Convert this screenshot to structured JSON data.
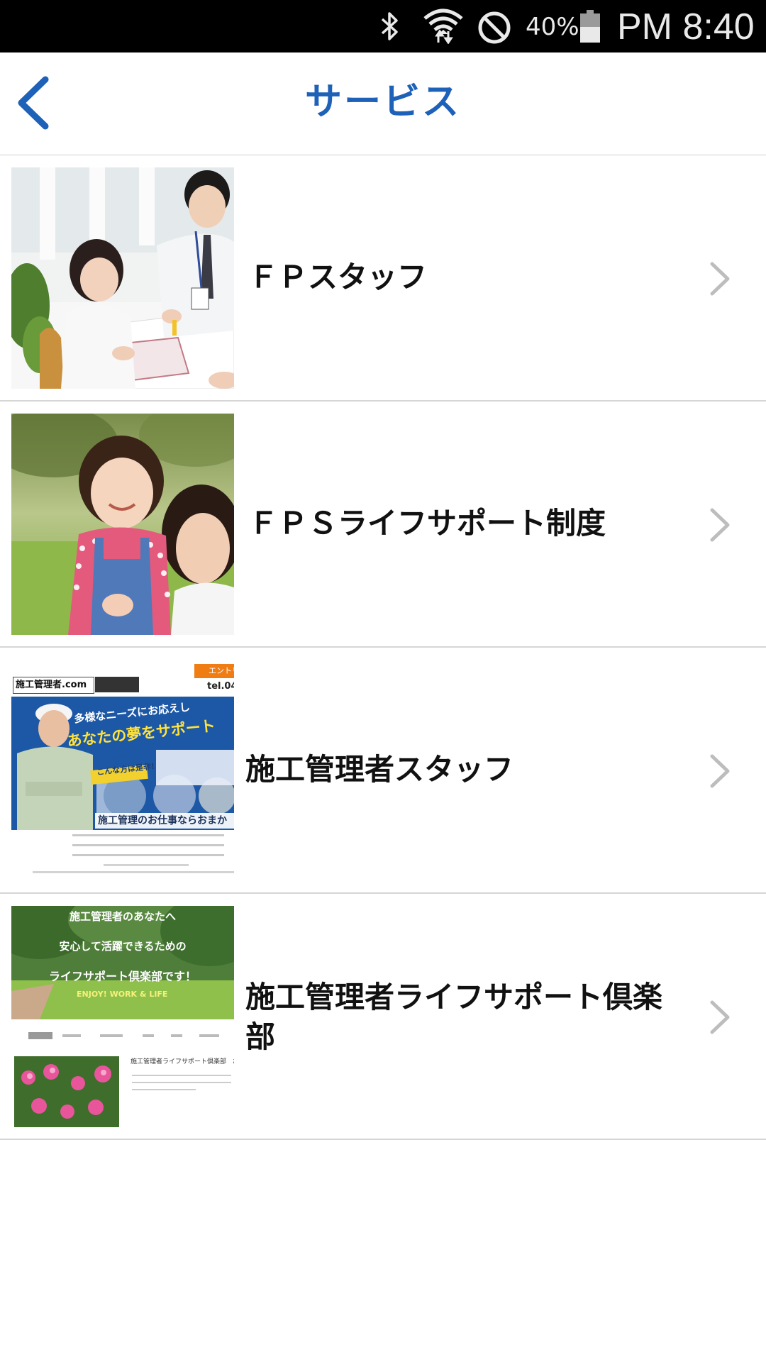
{
  "status_bar": {
    "battery_percent": "40%",
    "time": "PM 8:40",
    "icons": [
      "bluetooth-icon",
      "wifi-icon",
      "do-not-disturb-icon",
      "battery-icon"
    ]
  },
  "header": {
    "title": "サービス",
    "back_icon": "chevron-left-icon",
    "accent_color": "#1e61b8"
  },
  "services": [
    {
      "label": "ＦＰスタッフ",
      "thumbnail": "staff-meeting-photo"
    },
    {
      "label": "ＦＰＳライフサポート制度",
      "thumbnail": "mother-child-photo"
    },
    {
      "label": "施工管理者スタッフ",
      "thumbnail": "recruit-site-screenshot",
      "thumb_text": {
        "site_name": "施工管理者.com",
        "entry": "エントリ",
        "tel": "tel.04",
        "headline1": "多様なニーズにお応えし",
        "headline2": "あなたの夢をサポート",
        "badge": "こんな方は是非!",
        "footer": "施工管理のお仕事ならおまか"
      }
    },
    {
      "label": "施工管理者ライフサポート倶楽部",
      "thumbnail": "club-site-screenshot",
      "thumb_text": {
        "line1": "施工管理者のあなたへ",
        "line2": "安心して活躍できるための",
        "line3": "ライフサポート倶楽部です！",
        "slogan": "ENJOY! WORK & LIFE",
        "notice": "施工管理者ライフサポート倶楽部　お知らせ"
      }
    }
  ]
}
